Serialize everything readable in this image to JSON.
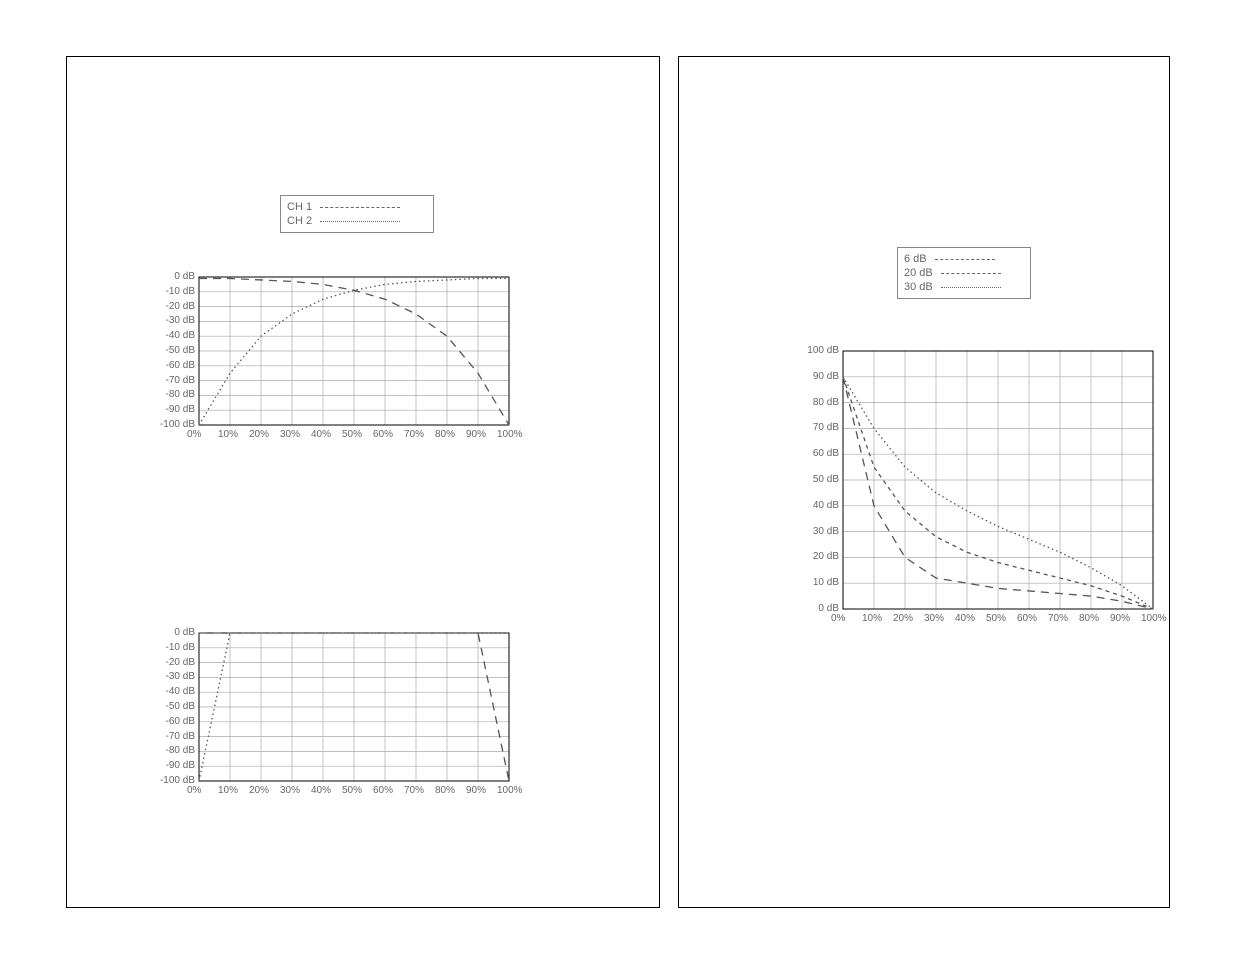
{
  "leftPanel": {
    "legend": {
      "items": [
        {
          "label": "CH 1",
          "style": "dash-long"
        },
        {
          "label": "CH 2",
          "style": "dotted"
        }
      ]
    },
    "chartA": {
      "yticks": [
        "0 dB",
        "-10 dB",
        "-20 dB",
        "-30 dB",
        "-40 dB",
        "-50 dB",
        "-60 dB",
        "-70 dB",
        "-80 dB",
        "-90 dB",
        "-100 dB"
      ],
      "xticks": [
        "0%",
        "10%",
        "20%",
        "30%",
        "40%",
        "50%",
        "60%",
        "70%",
        "80%",
        "90%",
        "100%"
      ]
    },
    "chartB": {
      "yticks": [
        "0 dB",
        "-10 dB",
        "-20 dB",
        "-30 dB",
        "-40 dB",
        "-50 dB",
        "-60 dB",
        "-70 dB",
        "-80 dB",
        "-90 dB",
        "-100 dB"
      ],
      "xticks": [
        "0%",
        "10%",
        "20%",
        "30%",
        "40%",
        "50%",
        "60%",
        "70%",
        "80%",
        "90%",
        "100%"
      ]
    }
  },
  "rightPanel": {
    "legend": {
      "items": [
        {
          "label": "6 dB",
          "style": "dash-long"
        },
        {
          "label": "20 dB",
          "style": "dash-short"
        },
        {
          "label": "30 dB",
          "style": "dotted"
        }
      ]
    },
    "chartC": {
      "yticks": [
        "100 dB",
        "90 dB",
        "80 dB",
        "70 dB",
        "60 dB",
        "50 dB",
        "40 dB",
        "30 dB",
        "20 dB",
        "10 dB",
        "0 dB"
      ],
      "xticks": [
        "0%",
        "10%",
        "20%",
        "30%",
        "40%",
        "50%",
        "60%",
        "70%",
        "80%",
        "90%",
        "100%"
      ]
    }
  },
  "chart_data": [
    {
      "id": "chartA",
      "type": "line",
      "xlabel": "",
      "ylabel": "",
      "x": [
        0,
        10,
        20,
        30,
        40,
        50,
        60,
        70,
        80,
        90,
        100
      ],
      "ylim": [
        -100,
        0
      ],
      "xlim": [
        0,
        100
      ],
      "series": [
        {
          "name": "CH 1",
          "style": "dash-long",
          "values": [
            -1,
            -1,
            -2,
            -3,
            -5,
            -9,
            -15,
            -25,
            -40,
            -65,
            -100
          ]
        },
        {
          "name": "CH 2",
          "style": "dotted",
          "values": [
            -100,
            -65,
            -40,
            -25,
            -15,
            -9,
            -5,
            -3,
            -2,
            -1,
            -1
          ]
        }
      ]
    },
    {
      "id": "chartB",
      "type": "line",
      "xlabel": "",
      "ylabel": "",
      "x": [
        0,
        10,
        20,
        30,
        40,
        50,
        60,
        70,
        80,
        90,
        100
      ],
      "ylim": [
        -100,
        0
      ],
      "xlim": [
        0,
        100
      ],
      "series": [
        {
          "name": "CH 1",
          "style": "dash-long",
          "values": [
            0,
            0,
            0,
            0,
            0,
            0,
            0,
            0,
            0,
            0,
            -100
          ]
        },
        {
          "name": "CH 2",
          "style": "dotted",
          "values": [
            -100,
            0,
            0,
            0,
            0,
            0,
            0,
            0,
            0,
            0,
            0
          ]
        }
      ]
    },
    {
      "id": "chartC",
      "type": "line",
      "xlabel": "",
      "ylabel": "",
      "x": [
        0,
        10,
        20,
        30,
        40,
        50,
        60,
        70,
        80,
        90,
        100
      ],
      "ylim": [
        0,
        100
      ],
      "xlim": [
        0,
        100
      ],
      "series": [
        {
          "name": "6 dB",
          "style": "dash-long",
          "values": [
            90,
            40,
            20,
            12,
            10,
            8,
            7,
            6,
            5,
            3,
            0
          ]
        },
        {
          "name": "20 dB",
          "style": "dash-short",
          "values": [
            90,
            55,
            38,
            28,
            22,
            18,
            15,
            12,
            9,
            5,
            0
          ]
        },
        {
          "name": "30 dB",
          "style": "dotted",
          "values": [
            90,
            70,
            55,
            45,
            38,
            32,
            27,
            22,
            16,
            9,
            0
          ]
        }
      ]
    }
  ]
}
